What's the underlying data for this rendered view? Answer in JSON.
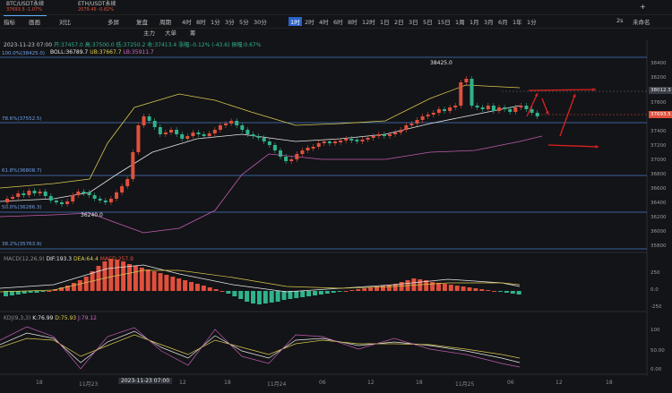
{
  "tabs": [
    {
      "label": "BTC/USDT永续",
      "sub": "37693.5 -1.07%"
    },
    {
      "label": "ETH/USDT永续",
      "sub": "2079.45 -0.82%"
    }
  ],
  "toolbar": {
    "items": [
      "指标",
      "画画",
      "对比",
      "多屏",
      "复盘",
      "周期",
      "4时",
      "8时",
      "1分",
      "3分",
      "5分",
      "30分",
      "1时",
      "2时",
      "4时",
      "6时",
      "8时",
      "12时",
      "1日",
      "2日",
      "3日",
      "5日",
      "15日",
      "1周",
      "1月",
      "3月",
      "6月",
      "1年",
      "1分"
    ],
    "selected": "1时",
    "special": [
      "主力",
      "大单",
      "筹"
    ],
    "right": [
      "2s",
      "未命名"
    ]
  },
  "info_bar": {
    "datetime": "2023-11-23 07:00",
    "open": "开:37457.0",
    "high": "高:37500.0",
    "low": "低:37250.2",
    "close": "收:37413.4",
    "change": "涨幅:-0.12% (-43.6)",
    "amplitude": "振幅:0.67%"
  },
  "boll": {
    "label": "BOLL:36789.7",
    "ub": "UB:37667.7",
    "lb": "LB:35911.7"
  },
  "fib_labels": [
    "100.0%(38425.0)",
    "78.6%(37552.5)",
    "61.8%(36808.7)",
    "50.0%(36286.3)",
    "38.2%(35763.9)"
  ],
  "annotations": {
    "high": "38425.0",
    "low": "36240.0"
  },
  "price_axis": [
    "38400",
    "38200",
    "38012.3",
    "37800",
    "37693.5",
    "37400",
    "37200",
    "37000",
    "36800",
    "36600",
    "36400",
    "36200",
    "36000",
    "35800"
  ],
  "current_price": "37693.5",
  "macd": {
    "label": "MACD(12,26,9)",
    "dif": "DIF:193.3",
    "dea": "DEA:64.4",
    "macd": "MACD:257.9",
    "axis": [
      "250",
      "0.0",
      "-250"
    ]
  },
  "kdj": {
    "label": "KDJ(9,3,3)",
    "k": "K:76.99",
    "d": "D:75.93",
    "j": "J:79.12",
    "axis": [
      "100",
      "50.00",
      "0.00"
    ]
  },
  "x_axis": [
    "18",
    "11月23",
    "2023-11-23 07:00",
    "12",
    "18",
    "11月24",
    "06",
    "12",
    "18",
    "11月25",
    "06",
    "12",
    "18"
  ],
  "colors": {
    "up": "#e0503c",
    "down": "#2fb38b",
    "boll_mid": "#e8e8e8",
    "boll_up": "#d8c850",
    "boll_low": "#c05cb0",
    "fib": "#4a78c8",
    "bg": "#131417"
  }
}
